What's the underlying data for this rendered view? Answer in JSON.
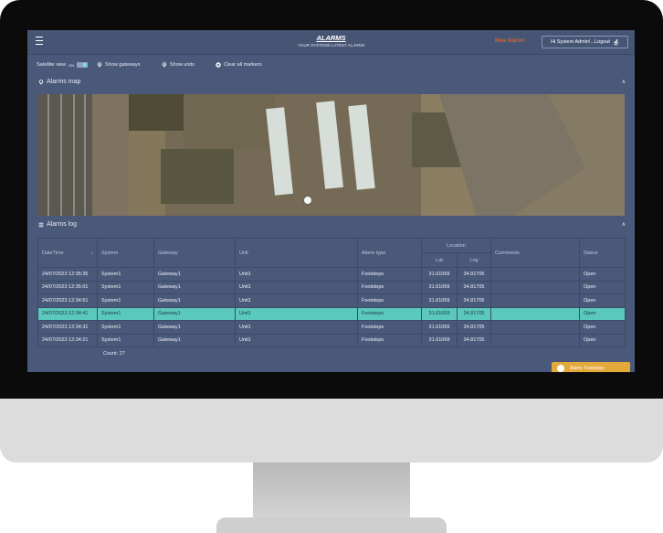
{
  "header": {
    "title": "ALARMS",
    "subtitle": "YOUR SYSTEMS LATEST ALARMS",
    "new_alarm": "New Alarm!",
    "user_button": "Hi System Admin!...Logout"
  },
  "toolbar": {
    "satellite_label": "Satellite view",
    "toggle_text": "ON",
    "show_gateways": "Show gateways",
    "show_units": "Show units",
    "clear_markers": "Clear all markers"
  },
  "map_section": {
    "title": "Alarms map"
  },
  "log_section": {
    "title": "Alarms log",
    "columns": {
      "datetime": "DateTime",
      "system": "System",
      "gateway": "Gateway",
      "unit": "Unit",
      "alarm_type": "Alarm type",
      "location": "Location",
      "lat": "Lat",
      "lng": "Lng",
      "comments": "Comments",
      "status": "Status"
    },
    "rows": [
      {
        "datetime": "24/07/2023 12:35:35",
        "system": "System1",
        "gateway": "Gateway1",
        "unit": "Unit1",
        "alarm_type": "Footsteps",
        "lat": "31.61069",
        "lng": "34.81705",
        "comments": "",
        "status": "Open"
      },
      {
        "datetime": "24/07/2023 12:35:01",
        "system": "System1",
        "gateway": "Gateway1",
        "unit": "Unit1",
        "alarm_type": "Footsteps",
        "lat": "31.61069",
        "lng": "34.81705",
        "comments": "",
        "status": "Open"
      },
      {
        "datetime": "24/07/2023 12:34:51",
        "system": "System1",
        "gateway": "Gateway1",
        "unit": "Unit1",
        "alarm_type": "Footsteps",
        "lat": "31.61069",
        "lng": "34.81705",
        "comments": "",
        "status": "Open"
      },
      {
        "datetime": "24/07/2023 12:34:41",
        "system": "System1",
        "gateway": "Gateway1",
        "unit": "Unit1",
        "alarm_type": "Footsteps",
        "lat": "31.61069",
        "lng": "34.81705",
        "comments": "",
        "status": "Open",
        "selected": true
      },
      {
        "datetime": "24/07/2023 12:34:31",
        "system": "System1",
        "gateway": "Gateway1",
        "unit": "Unit1",
        "alarm_type": "Footsteps",
        "lat": "31.61069",
        "lng": "34.81705",
        "comments": "",
        "status": "Open"
      },
      {
        "datetime": "24/07/2023 12:34:21",
        "system": "System1",
        "gateway": "Gateway1",
        "unit": "Unit1",
        "alarm_type": "Footsteps",
        "lat": "31.61069",
        "lng": "34.81705",
        "comments": "",
        "status": "Open"
      }
    ],
    "count": "Count: 27"
  },
  "alert_button": {
    "label": "Alarm: Footsteps"
  },
  "icons": {
    "menu": "hamburger-icon",
    "user": "running-person-icon",
    "map_pin": "map-pin-icon",
    "close": "close-circle-icon",
    "list": "list-icon",
    "chevron": "chevron-up-icon",
    "sort": "sort-arrow-icon"
  },
  "colors": {
    "screen_bg": "#4a5879",
    "selected_row": "#5ac8bc",
    "new_alarm": "#d8602e",
    "alert_button": "#e3a93a"
  }
}
